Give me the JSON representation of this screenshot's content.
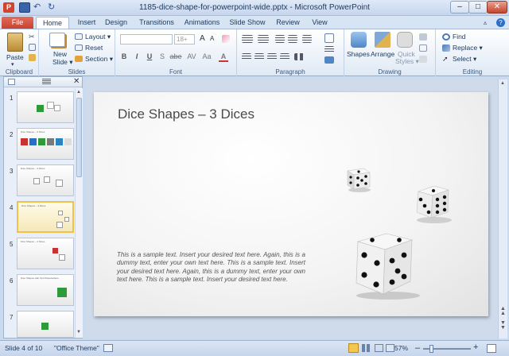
{
  "window": {
    "title": "1185-dice-shape-for-powerpoint-wide.pptx - Microsoft PowerPoint",
    "app_icon": "P",
    "quick_access": [
      "save-icon",
      "undo-icon",
      "redo-icon"
    ],
    "controls": {
      "minimize": "–",
      "maximize": "□",
      "close": "✕"
    }
  },
  "tabs": {
    "file": "File",
    "home": "Home",
    "insert": "Insert",
    "design": "Design",
    "transitions": "Transitions",
    "animations": "Animations",
    "slide_show": "Slide Show",
    "review": "Review",
    "view": "View"
  },
  "ribbon": {
    "clipboard": {
      "label": "Clipboard",
      "paste": "Paste"
    },
    "slides": {
      "label": "Slides",
      "new_slide": "New Slide",
      "new_slide_line1": "New",
      "new_slide_line2": "Slide ▾",
      "layout": "Layout ▾",
      "reset": "Reset",
      "section": "Section ▾"
    },
    "font": {
      "label": "Font",
      "font_name": "",
      "font_size": "18+",
      "bold": "B",
      "italic": "I",
      "underline": "U",
      "strike": "S",
      "shadow": "abe",
      "spacing": "AV",
      "case": "Aa",
      "color": "A",
      "grow": "A",
      "shrink": "A"
    },
    "paragraph": {
      "label": "Paragraph"
    },
    "drawing": {
      "label": "Drawing",
      "shapes": "Shapes",
      "arrange": "Arrange",
      "quick_styles": "Quick Styles",
      "quick_line1": "Quick",
      "quick_line2": "Styles ▾"
    },
    "editing": {
      "label": "Editing",
      "find": "Find",
      "replace": "Replace ▾",
      "select": "Select ▾"
    }
  },
  "slides_panel": {
    "thumbnails": [
      {
        "num": "1",
        "title": ""
      },
      {
        "num": "2",
        "title": "Dice Shapes – 6 Dices"
      },
      {
        "num": "3",
        "title": "Dice Shapes – 3 Dices"
      },
      {
        "num": "4",
        "title": "Dice Shapes – 3 Dices"
      },
      {
        "num": "5",
        "title": "Dice Shapes – 2 Dices"
      },
      {
        "num": "6",
        "title": "Dice Shapes with Text Placeholders"
      },
      {
        "num": "7",
        "title": ""
      }
    ],
    "selected": "4"
  },
  "slide": {
    "title": "Dice Shapes – 3 Dices",
    "body": "This is a sample text. Insert your desired text here. Again, this is a dummy text, enter your own text here. This is a sample text. Insert your desired text here. Again, this is a dummy text, enter your own text here. This is a sample text. Insert your desired text here."
  },
  "status": {
    "slide": "Slide 4 of 10",
    "theme": "\"Office Theme\"",
    "zoom": "57%",
    "zoom_out": "–",
    "zoom_in": "+"
  }
}
